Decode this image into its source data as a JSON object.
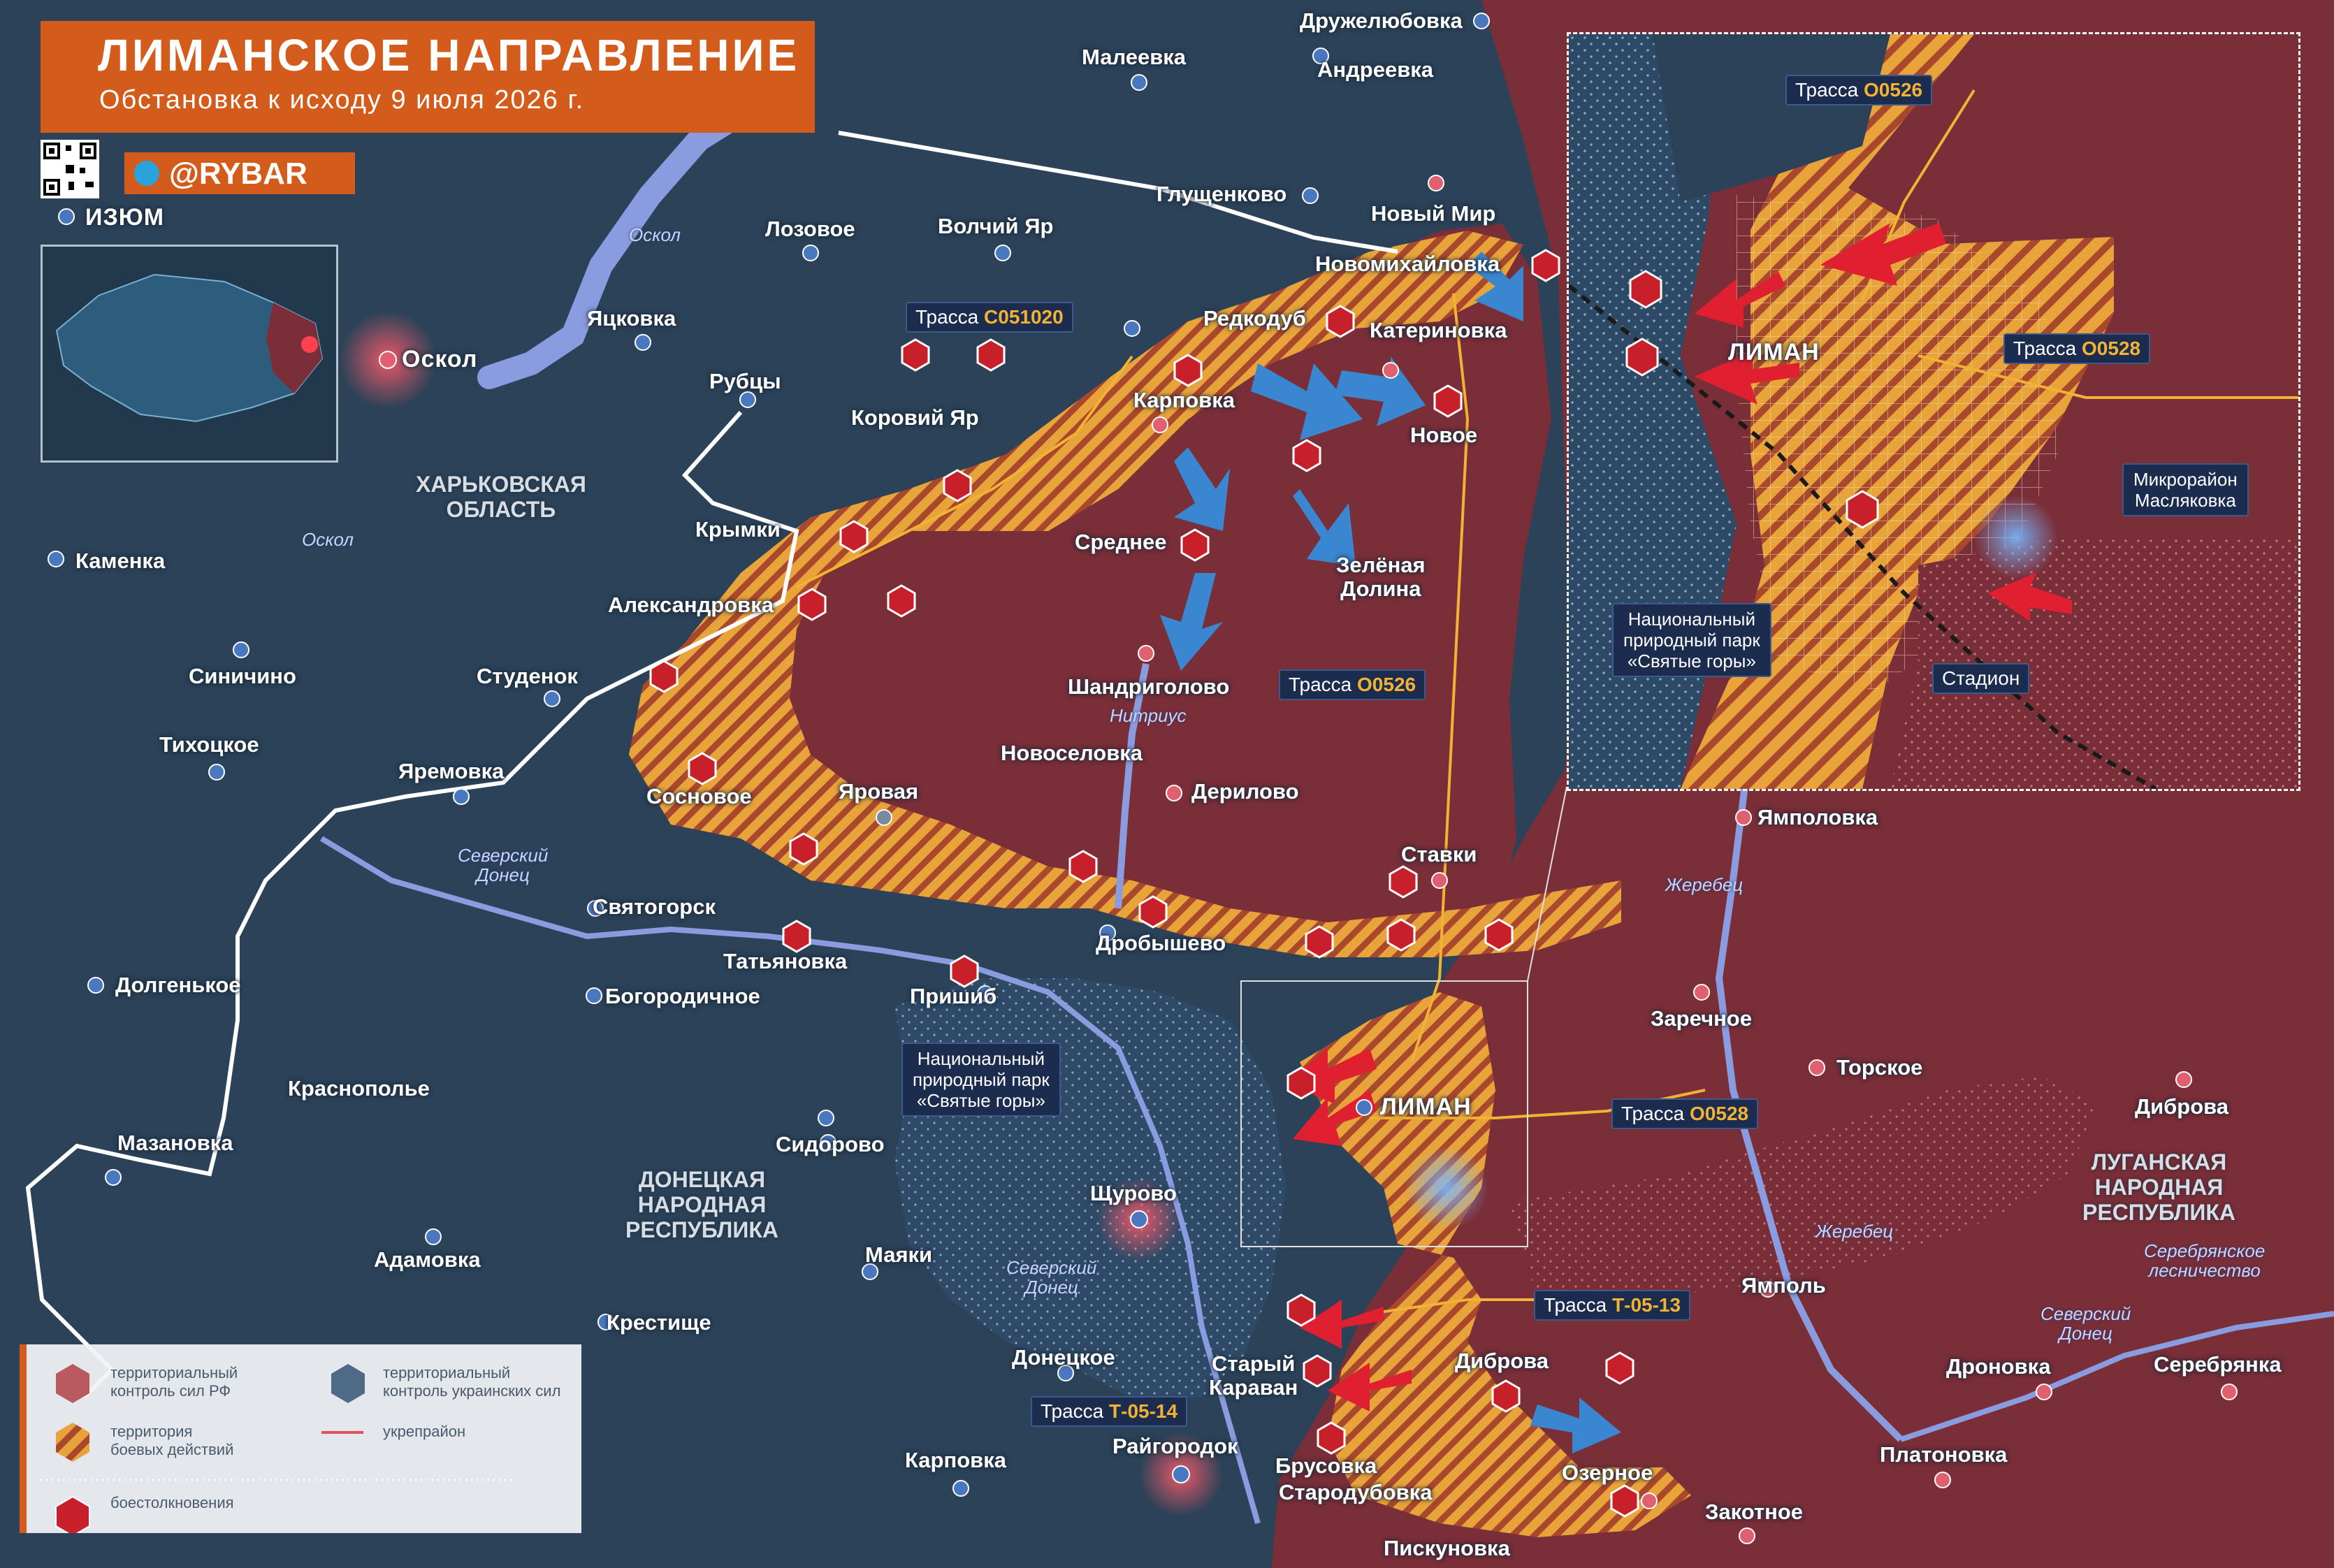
{
  "header": {
    "title": "ЛИМАНСКОЕ НАПРАВЛЕНИЕ",
    "subtitle": "Обстановка к исходу 9 июля 2026 г.",
    "brand": "@RYBAR"
  },
  "regions": {
    "kharkiv": "ХАРЬКОВСКАЯ\nОБЛАСТЬ",
    "donetsk": "ДОНЕЦКАЯ\nНАРОДНАЯ\nРЕСПУБЛИКА",
    "luhansk": "ЛУГАНСКАЯ\nНАРОДНАЯ\nРЕСПУБЛИКА",
    "serebryanskoe": "Серебрянское\nлесничество"
  },
  "rivers": {
    "oskol_1": "Оскол",
    "oskol_2": "Оскол",
    "seversky_donets_1": "Северский\nДонец",
    "seversky_donets_2": "Северский\nДонец",
    "seversky_donets_3": "Северский\nДонец",
    "nitrius": "Нитриус",
    "zherebets_1": "Жеребец",
    "zherebets_2": "Жеребец"
  },
  "settlements": {
    "izyum": "ИЗЮМ",
    "oskol": "Оскол",
    "druzhelyubovka": "Дружелюбовка",
    "maleevka": "Малеевка",
    "andreevka": "Андреевка",
    "glushchenkovo": "Глущенково",
    "lozovoe": "Лозовое",
    "volchiy_yar": "Волчий Яр",
    "novy_mir": "Новый Мир",
    "novomikhaylovka": "Новомихайловка",
    "yatskovka": "Яцковка",
    "rubtsy": "Рубцы",
    "redkodub": "Редкодуб",
    "katerinovka": "Катериновка",
    "karpovka_n": "Карповка",
    "novoe": "Новое",
    "koroviy_yar": "Коровий Яр",
    "krymki": "Крымки",
    "srednee": "Среднее",
    "zelenaya_dolina": "Зелёная\nДолина",
    "kamenka": "Каменка",
    "aleksandrovka": "Александровка",
    "sinichino": "Синичино",
    "studenok": "Студенок",
    "shandrigolovo": "Шандриголово",
    "tikhotskoe": "Тихоцкое",
    "yaremovka": "Яремовка",
    "novoselovka": "Новоселовка",
    "derilovo": "Дерилово",
    "sosnovoe": "Сосновое",
    "yarovaya": "Яровая",
    "stavki": "Ставки",
    "yampolovka": "Ямполовка",
    "svyatogorsk": "Святогорск",
    "tatyanovka": "Татьяновка",
    "drobyshevo": "Дробышево",
    "dolgenkoe": "Долгенькое",
    "bogorodichnoe": "Богородичное",
    "prishib": "Пришиб",
    "zarechnoe": "Заречное",
    "torskoe": "Торское",
    "krasnopolye": "Краснополье",
    "liman": "ЛИМАН",
    "dibrova_e": "Диброва",
    "mazanovka": "Мазановка",
    "sidorovo": "Сидорово",
    "shchurovo": "Щурово",
    "adamovka": "Адамовка",
    "mayaki": "Маяки",
    "yampol": "Ямполь",
    "krestishche": "Крестище",
    "donetskoe": "Донецкое",
    "stary_karavan": "Старый\nКараван",
    "dibrova_s": "Диброва",
    "dronovka": "Дроновка",
    "serebryanka": "Серебрянка",
    "raygorodok": "Райгородок",
    "karpovka_s": "Карповка",
    "brusovka": "Брусовка",
    "starodubovka": "Стародубовка",
    "platonovka": "Платоновка",
    "ozernoe": "Озерное",
    "zakotnoe": "Закотное",
    "piskunovka": "Пискуновка"
  },
  "roads": {
    "c051020": {
      "prefix": "Трасса",
      "code": "С051020"
    },
    "o0526": {
      "prefix": "Трасса",
      "code": "О0526"
    },
    "o0528": {
      "prefix": "Трасса",
      "code": "О0528"
    },
    "t0513": {
      "prefix": "Трасса",
      "code": "Т-05-13"
    },
    "t0514": {
      "prefix": "Трасса",
      "code": "Т-05-14"
    }
  },
  "park_label": "Национальный\nприродный парк\n«Святые горы»",
  "inset": {
    "road_o0526": {
      "prefix": "Трасса",
      "code": "О0526"
    },
    "road_o0528": {
      "prefix": "Трасса",
      "code": "О0528"
    },
    "liman": "ЛИМАН",
    "maslyakovka": "Микрорайон\nМасляковка",
    "park": "Национальный\nприродный парк\n«Святые горы»",
    "stadium": "Стадион"
  },
  "legend": {
    "ru_control": "территориальный\nконтроль сил РФ",
    "ua_control": "территориальный\nконтроль украинских сил",
    "combat": "территория\nбоевых действий",
    "fortified": "укрепрайон",
    "clashes": "боестолкновения"
  },
  "colors": {
    "ru_control": "#7a2e38",
    "ua_control": "#2c4258",
    "combat_a": "#e8a43a",
    "combat_b": "#a8482c",
    "accent": "#d35b1c",
    "clash": "#c8202a",
    "road": "#f2b233",
    "river": "#8a9ce0",
    "border": "#ffffff"
  }
}
